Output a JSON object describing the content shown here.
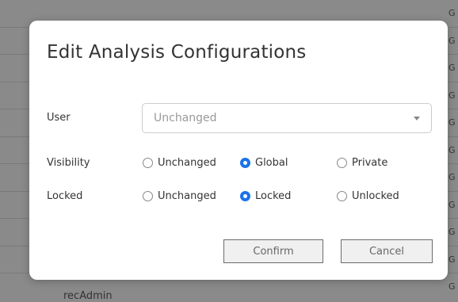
{
  "background": {
    "bottom_row_name": "recAdmin",
    "right_column_letter": "G"
  },
  "dialog": {
    "title": "Edit Analysis Configurations",
    "user": {
      "label": "User",
      "value": "Unchanged"
    },
    "visibility": {
      "label": "Visibility",
      "options": [
        "Unchanged",
        "Global",
        "Private"
      ],
      "selected": "Global"
    },
    "locked": {
      "label": "Locked",
      "options": [
        "Unchanged",
        "Locked",
        "Unlocked"
      ],
      "selected": "Locked"
    },
    "confirm_label": "Confirm",
    "cancel_label": "Cancel"
  },
  "colors": {
    "accent": "#1a73e8",
    "overlay": "#8a8a8a"
  }
}
